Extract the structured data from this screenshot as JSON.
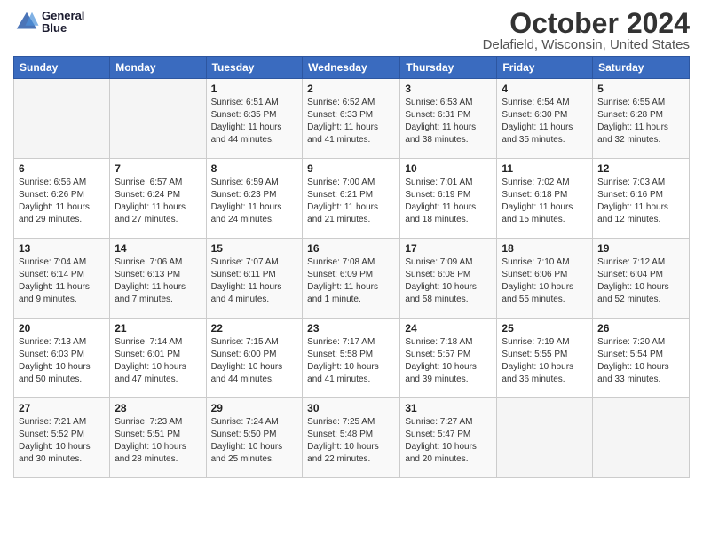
{
  "header": {
    "logo_line1": "General",
    "logo_line2": "Blue",
    "month": "October 2024",
    "location": "Delafield, Wisconsin, United States"
  },
  "weekdays": [
    "Sunday",
    "Monday",
    "Tuesday",
    "Wednesday",
    "Thursday",
    "Friday",
    "Saturday"
  ],
  "weeks": [
    [
      {
        "day": "",
        "info": ""
      },
      {
        "day": "",
        "info": ""
      },
      {
        "day": "1",
        "info": "Sunrise: 6:51 AM\nSunset: 6:35 PM\nDaylight: 11 hours and 44 minutes."
      },
      {
        "day": "2",
        "info": "Sunrise: 6:52 AM\nSunset: 6:33 PM\nDaylight: 11 hours and 41 minutes."
      },
      {
        "day": "3",
        "info": "Sunrise: 6:53 AM\nSunset: 6:31 PM\nDaylight: 11 hours and 38 minutes."
      },
      {
        "day": "4",
        "info": "Sunrise: 6:54 AM\nSunset: 6:30 PM\nDaylight: 11 hours and 35 minutes."
      },
      {
        "day": "5",
        "info": "Sunrise: 6:55 AM\nSunset: 6:28 PM\nDaylight: 11 hours and 32 minutes."
      }
    ],
    [
      {
        "day": "6",
        "info": "Sunrise: 6:56 AM\nSunset: 6:26 PM\nDaylight: 11 hours and 29 minutes."
      },
      {
        "day": "7",
        "info": "Sunrise: 6:57 AM\nSunset: 6:24 PM\nDaylight: 11 hours and 27 minutes."
      },
      {
        "day": "8",
        "info": "Sunrise: 6:59 AM\nSunset: 6:23 PM\nDaylight: 11 hours and 24 minutes."
      },
      {
        "day": "9",
        "info": "Sunrise: 7:00 AM\nSunset: 6:21 PM\nDaylight: 11 hours and 21 minutes."
      },
      {
        "day": "10",
        "info": "Sunrise: 7:01 AM\nSunset: 6:19 PM\nDaylight: 11 hours and 18 minutes."
      },
      {
        "day": "11",
        "info": "Sunrise: 7:02 AM\nSunset: 6:18 PM\nDaylight: 11 hours and 15 minutes."
      },
      {
        "day": "12",
        "info": "Sunrise: 7:03 AM\nSunset: 6:16 PM\nDaylight: 11 hours and 12 minutes."
      }
    ],
    [
      {
        "day": "13",
        "info": "Sunrise: 7:04 AM\nSunset: 6:14 PM\nDaylight: 11 hours and 9 minutes."
      },
      {
        "day": "14",
        "info": "Sunrise: 7:06 AM\nSunset: 6:13 PM\nDaylight: 11 hours and 7 minutes."
      },
      {
        "day": "15",
        "info": "Sunrise: 7:07 AM\nSunset: 6:11 PM\nDaylight: 11 hours and 4 minutes."
      },
      {
        "day": "16",
        "info": "Sunrise: 7:08 AM\nSunset: 6:09 PM\nDaylight: 11 hours and 1 minute."
      },
      {
        "day": "17",
        "info": "Sunrise: 7:09 AM\nSunset: 6:08 PM\nDaylight: 10 hours and 58 minutes."
      },
      {
        "day": "18",
        "info": "Sunrise: 7:10 AM\nSunset: 6:06 PM\nDaylight: 10 hours and 55 minutes."
      },
      {
        "day": "19",
        "info": "Sunrise: 7:12 AM\nSunset: 6:04 PM\nDaylight: 10 hours and 52 minutes."
      }
    ],
    [
      {
        "day": "20",
        "info": "Sunrise: 7:13 AM\nSunset: 6:03 PM\nDaylight: 10 hours and 50 minutes."
      },
      {
        "day": "21",
        "info": "Sunrise: 7:14 AM\nSunset: 6:01 PM\nDaylight: 10 hours and 47 minutes."
      },
      {
        "day": "22",
        "info": "Sunrise: 7:15 AM\nSunset: 6:00 PM\nDaylight: 10 hours and 44 minutes."
      },
      {
        "day": "23",
        "info": "Sunrise: 7:17 AM\nSunset: 5:58 PM\nDaylight: 10 hours and 41 minutes."
      },
      {
        "day": "24",
        "info": "Sunrise: 7:18 AM\nSunset: 5:57 PM\nDaylight: 10 hours and 39 minutes."
      },
      {
        "day": "25",
        "info": "Sunrise: 7:19 AM\nSunset: 5:55 PM\nDaylight: 10 hours and 36 minutes."
      },
      {
        "day": "26",
        "info": "Sunrise: 7:20 AM\nSunset: 5:54 PM\nDaylight: 10 hours and 33 minutes."
      }
    ],
    [
      {
        "day": "27",
        "info": "Sunrise: 7:21 AM\nSunset: 5:52 PM\nDaylight: 10 hours and 30 minutes."
      },
      {
        "day": "28",
        "info": "Sunrise: 7:23 AM\nSunset: 5:51 PM\nDaylight: 10 hours and 28 minutes."
      },
      {
        "day": "29",
        "info": "Sunrise: 7:24 AM\nSunset: 5:50 PM\nDaylight: 10 hours and 25 minutes."
      },
      {
        "day": "30",
        "info": "Sunrise: 7:25 AM\nSunset: 5:48 PM\nDaylight: 10 hours and 22 minutes."
      },
      {
        "day": "31",
        "info": "Sunrise: 7:27 AM\nSunset: 5:47 PM\nDaylight: 10 hours and 20 minutes."
      },
      {
        "day": "",
        "info": ""
      },
      {
        "day": "",
        "info": ""
      }
    ]
  ]
}
